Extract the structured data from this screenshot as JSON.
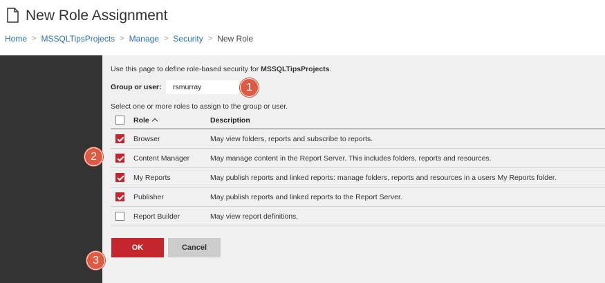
{
  "header": {
    "title": "New Role Assignment",
    "icon": "document-icon"
  },
  "breadcrumb": {
    "items": [
      "Home",
      "MSSQLTipsProjects",
      "Manage",
      "Security"
    ],
    "current": "New Role",
    "separator": ">"
  },
  "form": {
    "intro_prefix": "Use this page to define role-based security for ",
    "intro_target": "MSSQLTipsProjects",
    "intro_suffix": ".",
    "group_label": "Group or user:",
    "group_value": "rsmurray",
    "select_text": "Select one or more roles to assign to the group or user."
  },
  "table": {
    "columns": {
      "role": "Role",
      "description": "Description"
    },
    "rows": [
      {
        "role": "Browser",
        "description": "May view folders, reports and subscribe to reports.",
        "checked": true
      },
      {
        "role": "Content Manager",
        "description": "May manage content in the Report Server. This includes folders, reports and resources.",
        "checked": true
      },
      {
        "role": "My Reports",
        "description": "May publish reports and linked reports: manage folders, reports and resources in a users My Reports folder.",
        "checked": true
      },
      {
        "role": "Publisher",
        "description": "May publish reports and linked reports to the Report Server.",
        "checked": true
      },
      {
        "role": "Report Builder",
        "description": "May view report definitions.",
        "checked": false
      }
    ]
  },
  "buttons": {
    "ok": "OK",
    "cancel": "Cancel"
  },
  "callouts": [
    "1",
    "2",
    "3"
  ],
  "colors": {
    "accent": "#c4262e",
    "link": "#2a6ebb",
    "sidebar": "#333333",
    "callout": "#e05a43"
  }
}
